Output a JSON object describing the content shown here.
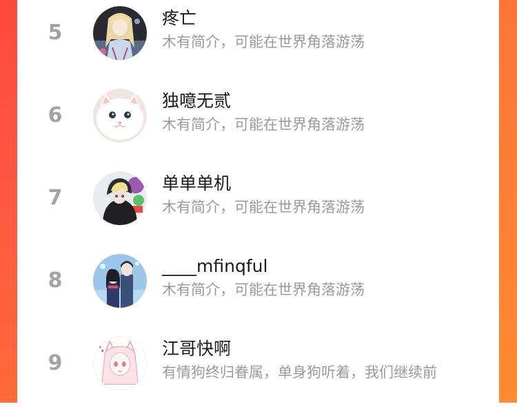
{
  "colors": {
    "background": "#ff4a3d",
    "card": "#ffffff",
    "rank": "#a3a3a3",
    "name": "#1a1a1a",
    "bio": "#9a9a9a"
  },
  "list": [
    {
      "rank": "5",
      "name": "疼亡",
      "bio": "木有简介，可能在世界角落游荡",
      "avatar": "anime-girl-blonde-avatar"
    },
    {
      "rank": "6",
      "name": "独噫无贰",
      "bio": "木有简介，可能在世界角落游荡",
      "avatar": "white-cat-avatar"
    },
    {
      "rank": "7",
      "name": "单单单机",
      "bio": "木有简介，可能在世界角落游荡",
      "avatar": "anime-boy-hoodie-avatar"
    },
    {
      "rank": "8",
      "name": "____mfinqful",
      "bio": "木有简介，可能在世界角落游荡",
      "avatar": "anime-couple-avatar"
    },
    {
      "rank": "9",
      "name": "江哥快啊",
      "bio": "有情狗终归眷属，单身狗听着，我们继续前",
      "avatar": "pink-sketch-girl-avatar"
    }
  ]
}
